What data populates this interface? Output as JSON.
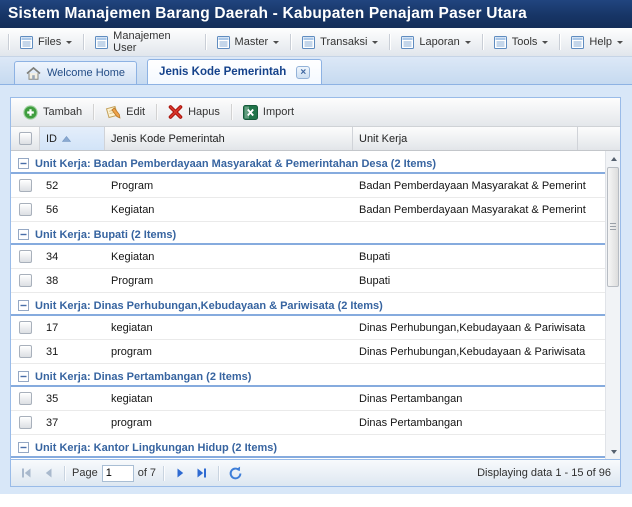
{
  "title_bar": {
    "title": "Sistem Manajemen Barang Daerah - Kabupaten Penajam Paser Utara"
  },
  "menu_bar": {
    "items": [
      {
        "label": "Files",
        "icon": "menu-list-icon",
        "has_arrow": true
      },
      {
        "label": "Manajemen User",
        "icon": "menu-list-icon",
        "has_arrow": false
      },
      {
        "label": "Master",
        "icon": "menu-list-icon",
        "has_arrow": true
      },
      {
        "label": "Transaksi",
        "icon": "menu-list-icon",
        "has_arrow": true
      },
      {
        "label": "Laporan",
        "icon": "menu-list-icon",
        "has_arrow": true
      },
      {
        "label": "Tools",
        "icon": "menu-list-icon",
        "has_arrow": true
      },
      {
        "label": "Help",
        "icon": "menu-list-icon",
        "has_arrow": true
      }
    ]
  },
  "tabs": [
    {
      "label": "Welcome Home",
      "icon": "home-icon",
      "active": false,
      "closable": false
    },
    {
      "label": "Jenis Kode Pemerintah",
      "icon": null,
      "active": true,
      "closable": true
    }
  ],
  "toolbar": {
    "buttons": [
      {
        "label": "Tambah",
        "icon": "add-icon"
      },
      {
        "label": "Edit",
        "icon": "edit-icon"
      },
      {
        "label": "Hapus",
        "icon": "delete-icon"
      },
      {
        "label": "Import",
        "icon": "excel-icon"
      }
    ]
  },
  "grid": {
    "columns": [
      "ID",
      "Jenis Kode Pemerintah",
      "Unit Kerja"
    ],
    "sort": {
      "column": "ID",
      "direction": "asc"
    },
    "groups": [
      {
        "header": "Unit Kerja: Badan Pemberdayaan Masyarakat & Pemerintahan Desa (2 Items)",
        "rows": [
          {
            "id": "52",
            "jenis": "Program",
            "unit": "Badan Pemberdayaan Masyarakat & Pemerint"
          },
          {
            "id": "56",
            "jenis": "Kegiatan",
            "unit": "Badan Pemberdayaan Masyarakat & Pemerint"
          }
        ]
      },
      {
        "header": "Unit Kerja: Bupati (2 Items)",
        "rows": [
          {
            "id": "34",
            "jenis": "Kegiatan",
            "unit": "Bupati"
          },
          {
            "id": "38",
            "jenis": "Program",
            "unit": "Bupati"
          }
        ]
      },
      {
        "header": "Unit Kerja: Dinas Perhubungan,Kebudayaan & Pariwisata (2 Items)",
        "rows": [
          {
            "id": "17",
            "jenis": "kegiatan",
            "unit": "Dinas Perhubungan,Kebudayaan & Pariwisata"
          },
          {
            "id": "31",
            "jenis": "program",
            "unit": "Dinas Perhubungan,Kebudayaan & Pariwisata"
          }
        ]
      },
      {
        "header": "Unit Kerja: Dinas Pertambangan (2 Items)",
        "rows": [
          {
            "id": "35",
            "jenis": "kegiatan",
            "unit": "Dinas Pertambangan"
          },
          {
            "id": "37",
            "jenis": "program",
            "unit": "Dinas Pertambangan"
          }
        ]
      },
      {
        "header": "Unit Kerja: Kantor Lingkungan Hidup (2 Items)",
        "rows": []
      }
    ]
  },
  "paging": {
    "page_label": "Page",
    "page_value": "1",
    "of_label": "of 7",
    "status": "Displaying data 1 - 15 of 96"
  },
  "colors": {
    "title_bar_bg": "#173566",
    "accent_blue": "#99bbe8",
    "group_header_text": "#3764a0",
    "active_tab_text": "#15428b",
    "add_green": "#3f9e3f",
    "delete_red": "#c41e14",
    "excel_green": "#20744a",
    "paging_enabled_arrow": "#2e6ad1",
    "paging_disabled_arrow": "#a9b9cd"
  }
}
